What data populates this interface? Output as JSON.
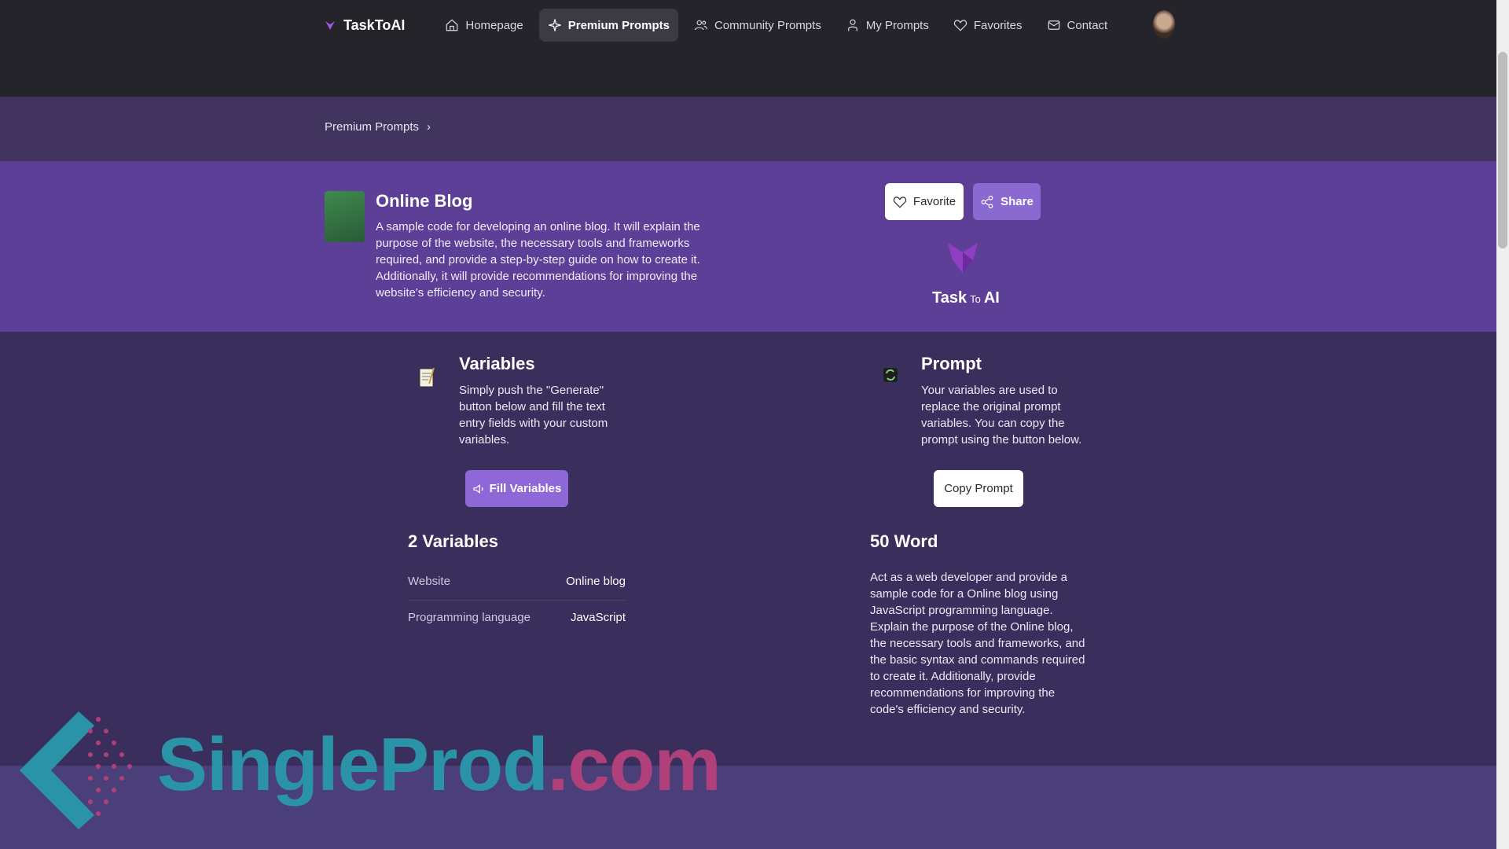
{
  "nav": {
    "brand": "TaskToAI",
    "items": [
      {
        "label": "Homepage",
        "icon": "home-icon",
        "active": false
      },
      {
        "label": "Premium Prompts",
        "icon": "sparkle-icon",
        "active": true
      },
      {
        "label": "Community Prompts",
        "icon": "users-icon",
        "active": false
      },
      {
        "label": "My Prompts",
        "icon": "user-icon",
        "active": false
      },
      {
        "label": "Favorites",
        "icon": "heart-icon",
        "active": false
      },
      {
        "label": "Contact",
        "icon": "mail-icon",
        "active": false
      }
    ]
  },
  "breadcrumb": {
    "item": "Premium Prompts",
    "separator": "›"
  },
  "hero": {
    "title": "Online Blog",
    "description": "A sample code for developing an online blog. It will explain the purpose of the website, the necessary tools and frameworks required, and provide a step-by-step guide on how to create it. Additionally, it will provide recommendations for improving the website's efficiency and security.",
    "favorite_label": "Favorite",
    "share_label": "Share",
    "logo_text_a": "Task",
    "logo_text_b": "To",
    "logo_text_c": "AI"
  },
  "variables_section": {
    "title": "Variables",
    "description": "Simply push the \"Generate\" button below and fill the text entry fields with your custom variables.",
    "button_label": "Fill Variables",
    "count_title": "2 Variables",
    "rows": [
      {
        "key": "Website",
        "value": "Online blog"
      },
      {
        "key": "Programming language",
        "value": "JavaScript"
      }
    ]
  },
  "prompt_section": {
    "title": "Prompt",
    "description": "Your variables  are used to replace the original prompt variables. You can copy the prompt using the button below.",
    "button_label": "Copy Prompt",
    "count_title": "50 Word",
    "text": "Act as a web developer and provide a sample code for a Online blog using JavaScript programming language. Explain the purpose of the Online blog, the necessary tools and frameworks, and the basic syntax and commands required to create it. Additionally, provide recommendations for improving the code's efficiency and security."
  },
  "watermark": {
    "part_a": "SingleProd",
    "part_b": ".com"
  },
  "colors": {
    "nav_bg": "#26242b",
    "hero_bg": "#5e3f98",
    "main_bg": "#3a2e5c",
    "accent": "#8d68d6"
  }
}
